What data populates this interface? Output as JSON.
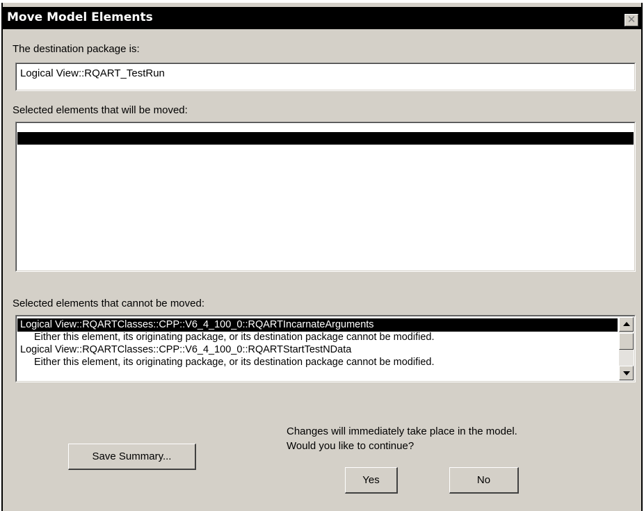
{
  "window": {
    "title": "Move Model Elements",
    "close_glyph": "✕"
  },
  "destination": {
    "label": "The destination package is:",
    "value": "Logical View::RQART_TestRun"
  },
  "movable": {
    "label": "Selected elements that will be moved:",
    "items": []
  },
  "unmovable": {
    "label": "Selected elements that cannot be moved:",
    "items": [
      "Logical View::RQARTClasses::CPP::V6_4_100_0::RQARTIncarnateArguments",
      "Either this element, its originating package, or its destination package cannot be modified.",
      "Logical View::RQARTClasses::CPP::V6_4_100_0::RQARTStartTestNData",
      "Either this element, its originating package, or its destination package cannot be modified."
    ]
  },
  "message": {
    "line1": "Changes will immediately take place in the model.",
    "line2": "Would you like to continue?"
  },
  "buttons": {
    "save_summary": "Save Summary...",
    "yes": "Yes",
    "no": "No"
  },
  "icons": {
    "scroll_up": "scroll-up-arrow-icon",
    "scroll_down": "scroll-down-arrow-icon",
    "close": "close-icon"
  }
}
